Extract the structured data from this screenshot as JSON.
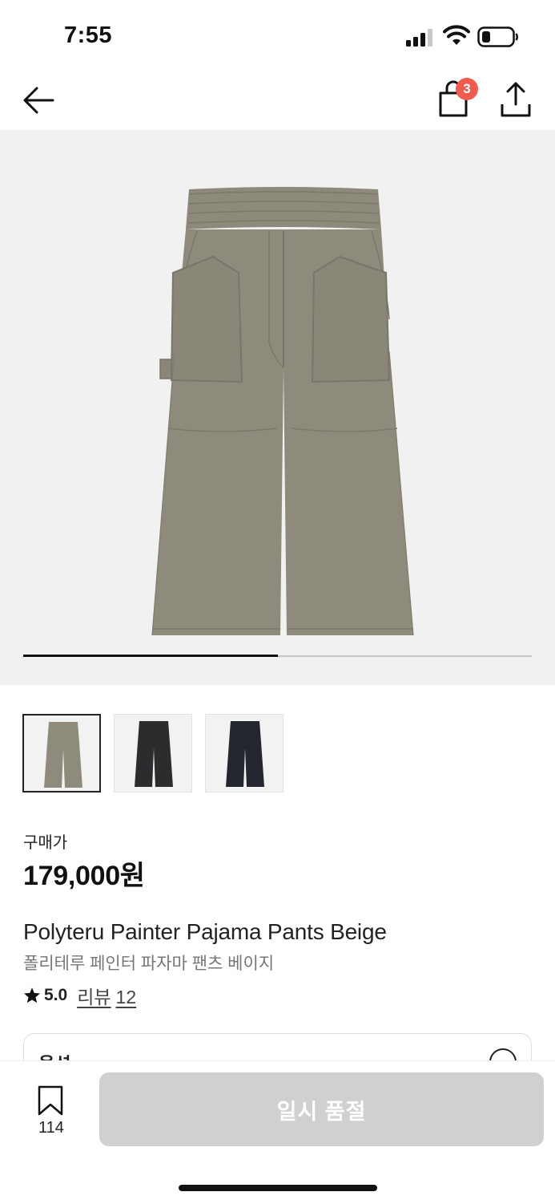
{
  "status_bar": {
    "time": "7:55",
    "icons": [
      "signal-icon",
      "wifi-icon",
      "battery-icon"
    ]
  },
  "nav": {
    "back_icon": "arrow-left-icon",
    "cart_icon": "shopping-bag-icon",
    "cart_badge": "3",
    "share_icon": "share-upload-icon"
  },
  "gallery": {
    "current_image_colorway": "beige",
    "progress": 0.5,
    "colors": {
      "background": "#f1f1f1",
      "progress_fill": "#111111"
    }
  },
  "thumbnails": [
    {
      "colorway": "beige",
      "color": "#8f8b7c",
      "selected": true
    },
    {
      "colorway": "black",
      "color": "#2c2c2e",
      "selected": false
    },
    {
      "colorway": "navy",
      "color": "#23262e",
      "selected": false
    }
  ],
  "product": {
    "price_label": "구매가",
    "price": "179,000원",
    "name_en": "Polyteru Painter Pajama Pants Beige",
    "name_ko": "폴리테루 페인터 파자마 팬츠 베이지",
    "rating": "5.0",
    "review_label": "리뷰",
    "review_count": "12"
  },
  "options": {
    "label": "옵션"
  },
  "bottom_bar": {
    "bookmark_count": "114",
    "cta_label": "일시 품절",
    "colors": {
      "cta_background": "#d0d0d0",
      "badge": "#ef5b4f"
    }
  }
}
